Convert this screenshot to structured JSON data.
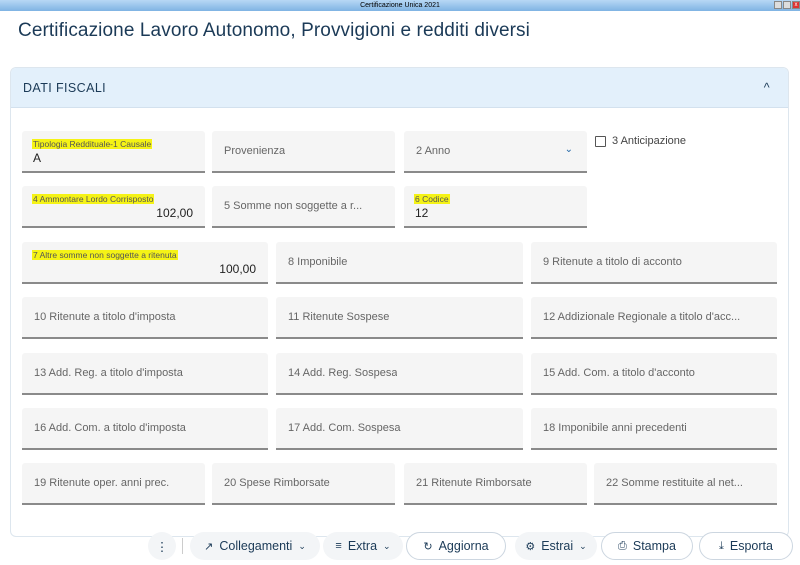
{
  "window": {
    "title": "Certificazione Unica 2021"
  },
  "page": {
    "title": "Certificazione Lavoro Autonomo, Provvigioni e redditi diversi"
  },
  "section": {
    "title": "DATI FISCALI"
  },
  "fields": {
    "tipologia": {
      "label": "Tipologia Reddituale-1 Causale",
      "value": "A"
    },
    "provenienza": {
      "label": "Provenienza"
    },
    "anno": {
      "label": "2 Anno"
    },
    "anticipazione": {
      "label": "3 Anticipazione",
      "checked": false
    },
    "f4": {
      "label": "4 Ammontare Lordo Corrisposto",
      "value": "102,00"
    },
    "f5": {
      "label": "5 Somme non soggette a r..."
    },
    "f6": {
      "label": "6 Codice",
      "value": "12"
    },
    "f7": {
      "label": "7 Altre somme non soggette a ritenuta",
      "value": "100,00"
    },
    "f8": {
      "label": "8 Imponibile"
    },
    "f9": {
      "label": "9 Ritenute a titolo di acconto"
    },
    "f10": {
      "label": "10 Ritenute a titolo d'imposta"
    },
    "f11": {
      "label": "11 Ritenute Sospese"
    },
    "f12": {
      "label": "12 Addizionale Regionale a titolo d'acc..."
    },
    "f13": {
      "label": "13 Add. Reg. a titolo d'imposta"
    },
    "f14": {
      "label": "14 Add. Reg. Sospesa"
    },
    "f15": {
      "label": "15 Add. Com. a titolo d'acconto"
    },
    "f16": {
      "label": "16 Add. Com. a titolo d'imposta"
    },
    "f17": {
      "label": "17 Add. Com. Sospesa"
    },
    "f18": {
      "label": "18 Imponibile anni precedenti"
    },
    "f19": {
      "label": "19 Ritenute oper. anni prec."
    },
    "f20": {
      "label": "20 Spese Rimborsate"
    },
    "f21": {
      "label": "21 Ritenute Rimborsate"
    },
    "f22": {
      "label": "22 Somme restituite al net..."
    }
  },
  "toolbar": {
    "more": "⋮",
    "collegamenti": "Collegamenti",
    "extra": "Extra",
    "aggiorna": "Aggiorna",
    "estrai": "Estrai",
    "stampa": "Stampa",
    "esporta": "Esporta"
  },
  "colors": {
    "accent": "#1b3a57",
    "header_bg": "#e3f0fb",
    "highlight": "#f5f316"
  }
}
